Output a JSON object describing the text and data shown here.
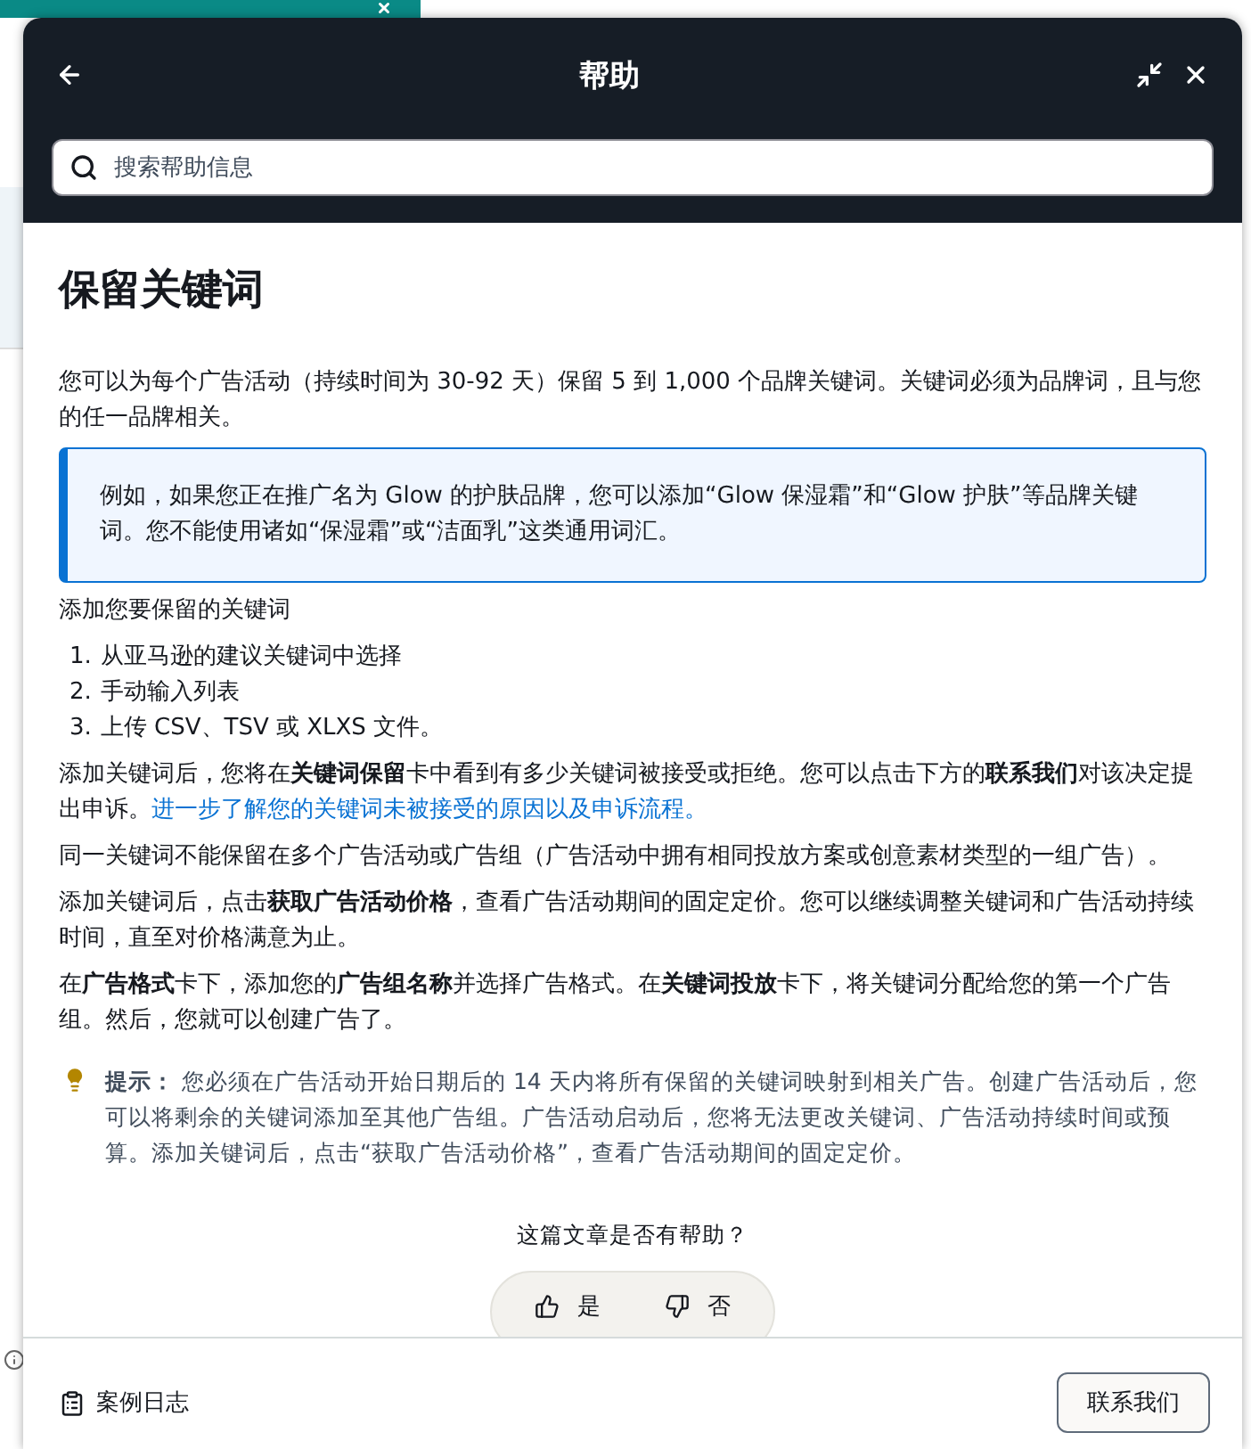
{
  "panel": {
    "title": "帮助",
    "search": {
      "placeholder": "搜索帮助信息"
    }
  },
  "article": {
    "heading": "保留关键词",
    "blocks": [
      {
        "kind": "paragraph",
        "parts": [
          {
            "kind": "text",
            "text": "您可以为每个广告活动（持续时间为 30-92 天）保留 5 到 1,000 个品牌关键词。关键词必须为品牌词，且与您的任一品牌相关。"
          }
        ]
      },
      {
        "kind": "callout",
        "text": "例如，如果您正在推广名为 Glow 的护肤品牌，您可以添加“Glow 保湿霜”和“Glow 护肤”等品牌关键词。您不能使用诸如“保湿霜”或“洁面乳”这类通用词汇。"
      },
      {
        "kind": "paragraph",
        "parts": [
          {
            "kind": "text",
            "text": "添加您要保留的关键词"
          }
        ]
      },
      {
        "kind": "list",
        "items": [
          {
            "number": "1.",
            "text": "从亚马逊的建议关键词中选择"
          },
          {
            "number": "2.",
            "text": "手动输入列表"
          },
          {
            "number": "3.",
            "text": "上传 CSV、TSV 或 XLXS 文件。"
          }
        ]
      },
      {
        "kind": "paragraph",
        "parts": [
          {
            "kind": "text",
            "text": "添加关键词后，您将在**关键词保留**卡中看到有多少关键词被接受或拒绝。您可以点击下方的**联系我们**对该决定提出申诉。"
          },
          {
            "kind": "link",
            "text": "进一步了解您的关键词未被接受的原因以及申诉流程。"
          }
        ]
      },
      {
        "kind": "paragraph",
        "parts": [
          {
            "kind": "text",
            "text": "同一关键词不能保留在多个广告活动或广告组（广告活动中拥有相同投放方案或创意素材类型的一组广告）。"
          }
        ]
      },
      {
        "kind": "paragraph",
        "parts": [
          {
            "kind": "text",
            "text": "添加关键词后，点击**获取广告活动价格**，查看广告活动期间的固定定价。您可以继续调整关键词和广告活动持续时间，直至对价格满意为止。"
          }
        ]
      },
      {
        "kind": "paragraph",
        "parts": [
          {
            "kind": "text",
            "text": "在**广告格式**卡下，添加您的**广告组名称**并选择广告格式。在**关键词投放**卡下，将关键词分配给您的第一个广告组。然后，您就可以创建广告了。"
          }
        ]
      },
      {
        "kind": "tip",
        "label": "提示：",
        "text": "您必须在广告活动开始日期后的 14 天内将所有保留的关键词映射到相关广告。创建广告活动后，您可以将剩余的关键词添加至其他广告组。广告活动启动后，您将无法更改关键词、广告活动持续时间或预算。添加关键词后，点击“获取广告活动价格”，查看广告活动期间的固定定价。"
      }
    ],
    "feedback": {
      "question": "这篇文章是否有帮助？",
      "yes": "是",
      "no": "否"
    }
  },
  "footer": {
    "case_log": "案例日志",
    "contact_button": "联系我们"
  }
}
